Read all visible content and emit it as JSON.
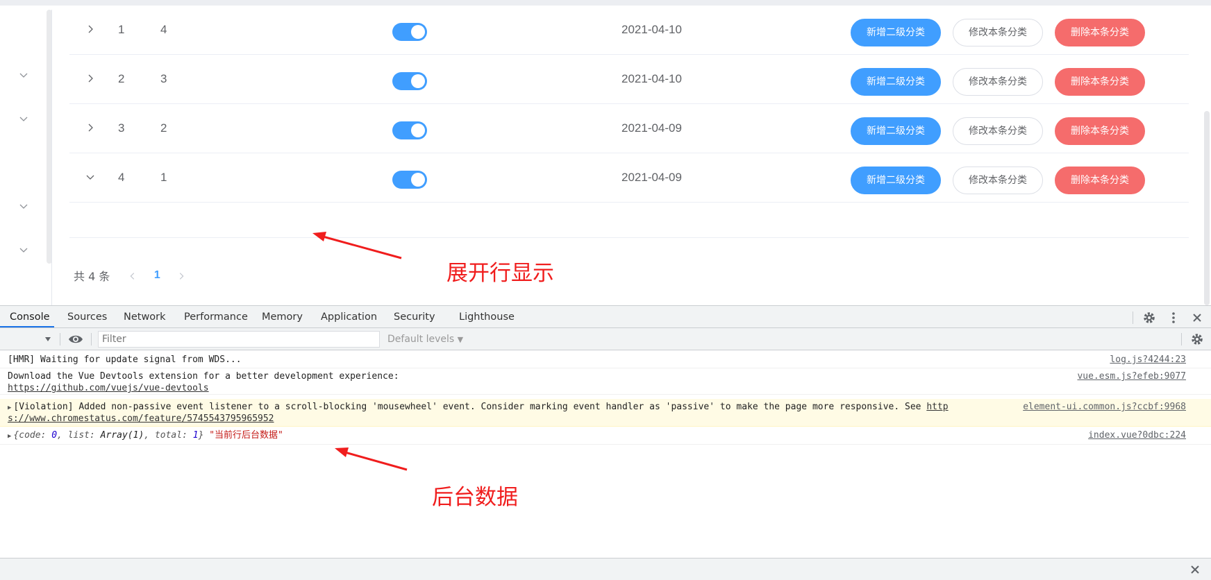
{
  "table": {
    "rows": [
      {
        "id": "1",
        "sort": "4",
        "date": "2021-04-10",
        "expanded": false
      },
      {
        "id": "2",
        "sort": "3",
        "date": "2021-04-10",
        "expanded": false
      },
      {
        "id": "3",
        "sort": "2",
        "date": "2021-04-09",
        "expanded": false
      },
      {
        "id": "4",
        "sort": "1",
        "date": "2021-04-09",
        "expanded": true
      }
    ],
    "buttons": {
      "add_sub": "新增二级分类",
      "edit": "修改本条分类",
      "delete": "删除本条分类"
    }
  },
  "pagination": {
    "total": "共 4 条",
    "current_page": "1"
  },
  "annotations": {
    "expanded_row": "展开行显示",
    "backend_data": "后台数据"
  },
  "devtools": {
    "tabs": [
      "Console",
      "Sources",
      "Network",
      "Performance",
      "Memory",
      "Application",
      "Security",
      "Lighthouse"
    ],
    "active_tab": "Console",
    "filter_placeholder": "Filter",
    "levels": "Default levels",
    "logs": {
      "hmr": {
        "message": "[HMR] Waiting for update signal from WDS...",
        "source": "log.js?4244:23"
      },
      "vue": {
        "message": "Download the Vue Devtools extension for a better development experience:",
        "link": "https://github.com/vuejs/vue-devtools",
        "source": "vue.esm.js?efeb:9077"
      },
      "violation": {
        "message": "[Violation] Added non-passive event listener to a scroll-blocking 'mousewheel' event. Consider marking event handler as 'passive' to make the page more responsive. See ",
        "link_part1": "http",
        "link_part2": "s://www.chromestatus.com/feature/5745543795965952",
        "source": "element-ui.common.js?ccbf:9968"
      },
      "object": {
        "open": "{",
        "code_key": "code: ",
        "code_val": "0",
        "list_key": ", list: ",
        "list_val": "Array(1)",
        "total_key": ", total: ",
        "total_val": "1",
        "close": "}",
        "label": "\"当前行后台数据\"",
        "source": "index.vue?0dbc:224"
      }
    }
  }
}
